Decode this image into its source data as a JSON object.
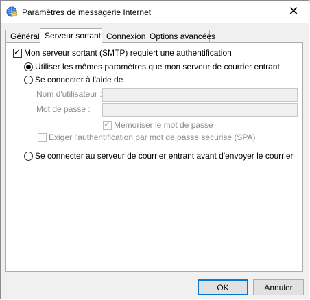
{
  "window": {
    "title": "Paramètres de messagerie Internet",
    "close_glyph": "✕",
    "app_icon": "globe-mail-icon"
  },
  "tabs": [
    {
      "label": "Général",
      "active": false
    },
    {
      "label": "Serveur sortant",
      "active": true
    },
    {
      "label": "Connexion",
      "active": false
    },
    {
      "label": "Options avancées",
      "active": false
    }
  ],
  "smtp_auth": {
    "label": "Mon serveur sortant (SMTP) requiert une authentification",
    "checked": true
  },
  "options": {
    "same_settings": "Utiliser les mêmes paramètres que mon serveur de courrier entrant",
    "login_with": "Se connecter à l'aide de",
    "username_label": "Nom d'utilisateur :",
    "password_label": "Mot de passe :",
    "remember_password": "Mémoriser le mot de passe",
    "require_spa": "Exiger l'authentification par mot de passe sécurisé (SPA)",
    "login_incoming_first": "Se connecter au serveur de courrier entrant avant d'envoyer le courrier",
    "selected": "same_settings",
    "remember_password_checked": true,
    "require_spa_checked": false
  },
  "fields": {
    "username_value": "",
    "password_value": ""
  },
  "buttons": {
    "ok": "OK",
    "cancel": "Annuler"
  }
}
